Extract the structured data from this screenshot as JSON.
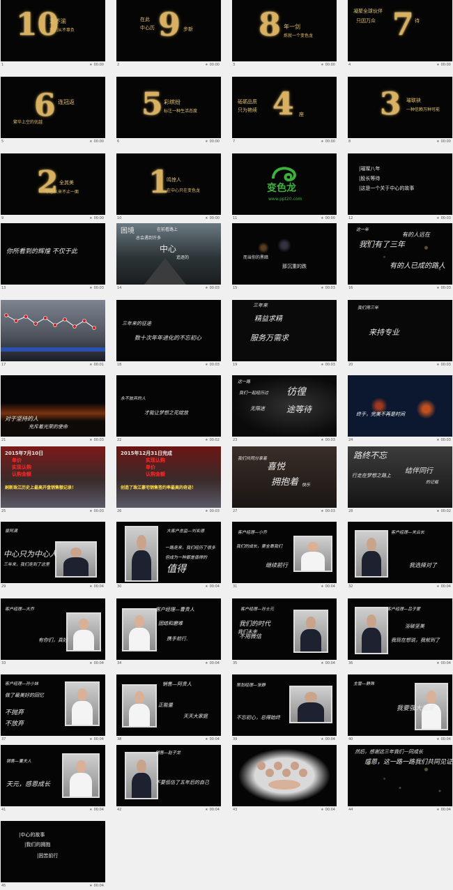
{
  "slides": [
    {
      "n": "1",
      "t": "00:00",
      "big": "10",
      "lines": [
        "志不渝",
        "我们从不辜负"
      ]
    },
    {
      "n": "2",
      "t": "00:00",
      "big": "9",
      "lines": [
        "在此",
        "中心历",
        "步新"
      ]
    },
    {
      "n": "3",
      "t": "00:00",
      "big": "8",
      "lines": [
        "年一剑",
        "炼就一个变色龙"
      ]
    },
    {
      "n": "4",
      "t": "00:00",
      "big": "7",
      "lines": [
        "凝聚全球伙伴",
        "只因万众",
        "待"
      ]
    },
    {
      "n": "5",
      "t": "00:00",
      "big": "6",
      "lines": [
        "连冠返",
        "繁华上空的优越"
      ]
    },
    {
      "n": "6",
      "t": "00:00",
      "big": "5",
      "lines": [
        "彩缤纷",
        "标注一种生活态度"
      ]
    },
    {
      "n": "7",
      "t": "00:00",
      "big": "4",
      "lines": [
        "砥砺品质",
        "只为艳续",
        "座"
      ]
    },
    {
      "n": "8",
      "t": "00:00",
      "big": "3",
      "lines": [
        "璀联袂",
        "一种信赖万种可能"
      ]
    },
    {
      "n": "9",
      "t": "00:00",
      "big": "2",
      "lines": [
        "全其美",
        "中心从来不止一面"
      ]
    },
    {
      "n": "10",
      "t": "00:00",
      "big": "1",
      "lines": [
        "鸣惊人",
        "在中心只在变色龙"
      ]
    },
    {
      "n": "11",
      "t": "00:00",
      "logo": "变色龙",
      "url": "www.ppt20.com"
    },
    {
      "n": "12",
      "t": "00:03",
      "lines": [
        "|璀璨八年",
        "|股长等待",
        "|这是一个关于中心的故事"
      ]
    },
    {
      "n": "13",
      "t": "00:03",
      "lines": [
        "你所看到的辉煌 不仅于此"
      ]
    },
    {
      "n": "14",
      "t": "00:03",
      "lines": [
        "困境",
        "总会遇到许多",
        "在前看路上",
        "中心",
        "追逐的"
      ]
    },
    {
      "n": "15",
      "t": "00:03",
      "lines": [
        "而当你的黑暗",
        "那沉重的跌"
      ]
    },
    {
      "n": "16",
      "t": "00:03",
      "lines": [
        "这一年",
        "我们有了三年",
        "有的人远在",
        "有的人已成的路人"
      ]
    },
    {
      "n": "17",
      "t": "00:01",
      "lines": []
    },
    {
      "n": "18",
      "t": "00:03",
      "lines": [
        "三年来的征途",
        "数十次年年进化的不忘初心"
      ]
    },
    {
      "n": "19",
      "t": "00:03",
      "lines": [
        "三年来",
        "精益求精",
        "服务万需求"
      ]
    },
    {
      "n": "20",
      "t": "00:03",
      "lines": [
        "我们用三年",
        "来持专业"
      ]
    },
    {
      "n": "21",
      "t": "00:03",
      "lines": [
        "对于坚持的人",
        "充斥着光荣的使命"
      ]
    },
    {
      "n": "22",
      "t": "00:02",
      "lines": [
        "永不放弃的人",
        "才能让梦想之花绽放"
      ]
    },
    {
      "n": "23",
      "t": "00:03",
      "lines": [
        "这一路",
        "我们一起经历过",
        "彷徨",
        "无限迷",
        "途等待"
      ]
    },
    {
      "n": "24",
      "t": "00:03",
      "lines": [
        "终于，完美不再是时间"
      ]
    },
    {
      "n": "25",
      "t": "00:03",
      "lines": [
        "2015年7月10日",
        "单价",
        "实现认购",
        "认购金额",
        "刷新珠江历史上最高开盘销售额记录！"
      ]
    },
    {
      "n": "26",
      "t": "00:03",
      "lines": [
        "2015年12月31日完成",
        "实现认购",
        "单价",
        "认购金额",
        "创造了珠江豪宅销售签约率最高的奇迹！"
      ]
    },
    {
      "n": "27",
      "t": "00:03",
      "lines": [
        "我们共同分享着",
        "喜悦",
        "拥抱着",
        "快乐"
      ]
    },
    {
      "n": "28",
      "t": "00:02",
      "lines": [
        "路终不忘",
        "行走在梦想之路上",
        "结伴同行",
        "的记载"
      ]
    },
    {
      "n": "29",
      "t": "00:04",
      "lines": [
        "曾阿满",
        "中心只为中心人",
        "三年来，我们走到了这里"
      ]
    },
    {
      "n": "30",
      "t": "00:04",
      "lines": [
        "大客户总监—刘玄德",
        "一路走来，我们经历了很多",
        "但成为一种都是值得的",
        "值得"
      ]
    },
    {
      "n": "31",
      "t": "00:04",
      "lines": [
        "客户经理—小乔",
        "我们的成长，要全靠我们",
        "继续前行"
      ]
    },
    {
      "n": "32",
      "t": "00:04",
      "lines": [
        "客户经理—关云长",
        "我选择对了"
      ]
    },
    {
      "n": "33",
      "t": "00:04",
      "lines": [
        "客户经理—大乔",
        "有你们，真好"
      ]
    },
    {
      "n": "34",
      "t": "00:04",
      "lines": [
        "客户经理—曹贵人",
        "团结和磨难",
        "携手前行."
      ]
    },
    {
      "n": "35",
      "t": "00:04",
      "lines": [
        "客户经理—孙士元",
        "我们的时代",
        "不用微信",
        "我们未来"
      ]
    },
    {
      "n": "36",
      "t": "00:04",
      "lines": [
        "客户经理—吕子蒙",
        "浴破坚美",
        "我现在想说，我就到了"
      ]
    },
    {
      "n": "37",
      "t": "00:04",
      "lines": [
        "客户经理—孙小妹",
        "做了最美好的回忆",
        "不抛弃",
        "不放弃"
      ]
    },
    {
      "n": "38",
      "t": "00:04",
      "lines": [
        "销售—阿贵人",
        "正能量",
        "天天大家庭"
      ]
    },
    {
      "n": "39",
      "t": "00:04",
      "lines": [
        "策划经理—张静",
        "不忘初心，总得始终"
      ]
    },
    {
      "n": "40",
      "t": "00:04",
      "lines": [
        "主管—静殊",
        "我要强大起来"
      ]
    },
    {
      "n": "41",
      "t": "00:04",
      "lines": [
        "销售—董夫人",
        "天元，感恩成长"
      ]
    },
    {
      "n": "42",
      "t": "00:04",
      "lines": [
        "销售—赵子龙",
        "不要低估了五年后的自己"
      ]
    },
    {
      "n": "43",
      "t": "00:04",
      "lines": []
    },
    {
      "n": "44",
      "t": "00:04",
      "lines": [
        "然后，感谢这三年我们一同成长",
        "感恩，这一路一路我们共同见证"
      ]
    },
    {
      "n": "45",
      "t": "00:04",
      "lines": [
        "|中心的故事",
        "|我们的拥抱",
        "|困苦前行"
      ]
    }
  ]
}
